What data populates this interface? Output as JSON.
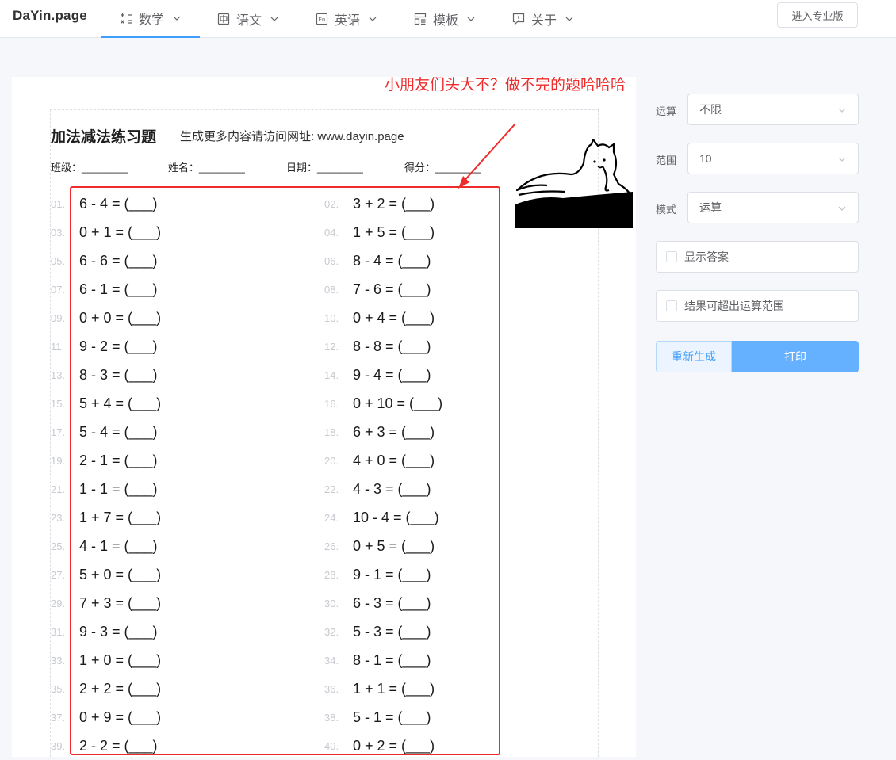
{
  "brand": "DaYin.page",
  "nav": [
    {
      "label": "数学",
      "icon": "calculator-icon",
      "active": true
    },
    {
      "label": "语文",
      "icon": "chinese-char-icon",
      "active": false
    },
    {
      "label": "英语",
      "icon": "english-icon",
      "active": false
    },
    {
      "label": "模板",
      "icon": "template-icon",
      "active": false
    },
    {
      "label": "关于",
      "icon": "info-message-icon",
      "active": false
    }
  ],
  "pro_button": "进入专业版",
  "sheet": {
    "title": "加法减法练习题",
    "subtitle": "生成更多内容请访问网址:   www.dayin.page",
    "fields": [
      "班级：________",
      "姓名：________",
      "日期：________",
      "得分：________"
    ],
    "problems": [
      {
        "no": "01.",
        "expr": "6 - 4 = (___)"
      },
      {
        "no": "02.",
        "expr": "3 + 2 = (___)"
      },
      {
        "no": "03.",
        "expr": "0 + 1 = (___)"
      },
      {
        "no": "04.",
        "expr": "1 + 5 = (___)"
      },
      {
        "no": "05.",
        "expr": "6 - 6 = (___)"
      },
      {
        "no": "06.",
        "expr": "8 - 4 = (___)"
      },
      {
        "no": "07.",
        "expr": "6 - 1 = (___)"
      },
      {
        "no": "08.",
        "expr": "7 - 6 = (___)"
      },
      {
        "no": "09.",
        "expr": "0 + 0 = (___)"
      },
      {
        "no": "10.",
        "expr": "0 + 4 = (___)"
      },
      {
        "no": "11.",
        "expr": "9 - 2 = (___)"
      },
      {
        "no": "12.",
        "expr": "8 - 8 = (___)"
      },
      {
        "no": "13.",
        "expr": "8 - 3 = (___)"
      },
      {
        "no": "14.",
        "expr": "9 - 4 = (___)"
      },
      {
        "no": "15.",
        "expr": "5 + 4 = (___)"
      },
      {
        "no": "16.",
        "expr": "0 + 10 = (___)"
      },
      {
        "no": "17.",
        "expr": "5 - 4 = (___)"
      },
      {
        "no": "18.",
        "expr": "6 + 3 = (___)"
      },
      {
        "no": "19.",
        "expr": "2 - 1 = (___)"
      },
      {
        "no": "20.",
        "expr": "4 + 0 = (___)"
      },
      {
        "no": "21.",
        "expr": "1 - 1 = (___)"
      },
      {
        "no": "22.",
        "expr": "4 - 3 = (___)"
      },
      {
        "no": "23.",
        "expr": "1 + 7 = (___)"
      },
      {
        "no": "24.",
        "expr": "10 - 4 = (___)"
      },
      {
        "no": "25.",
        "expr": "4 - 1 = (___)"
      },
      {
        "no": "26.",
        "expr": "0 + 5 = (___)"
      },
      {
        "no": "27.",
        "expr": "5 + 0 = (___)"
      },
      {
        "no": "28.",
        "expr": "9 - 1 = (___)"
      },
      {
        "no": "29.",
        "expr": "7 + 3 = (___)"
      },
      {
        "no": "30.",
        "expr": "6 - 3 = (___)"
      },
      {
        "no": "31.",
        "expr": "9 - 3 = (___)"
      },
      {
        "no": "32.",
        "expr": "5 - 3 = (___)"
      },
      {
        "no": "33.",
        "expr": "1 + 0 = (___)"
      },
      {
        "no": "34.",
        "expr": "8 - 1 = (___)"
      },
      {
        "no": "35.",
        "expr": "2 + 2 = (___)"
      },
      {
        "no": "36.",
        "expr": "1 + 1 = (___)"
      },
      {
        "no": "37.",
        "expr": "0 + 9 = (___)"
      },
      {
        "no": "38.",
        "expr": "5 - 1 = (___)"
      },
      {
        "no": "39.",
        "expr": "2 - 2 = (___)"
      },
      {
        "no": "40.",
        "expr": "0 + 2 = (___)"
      }
    ]
  },
  "annotation": "小朋友们头大不？做不完的题哈哈哈",
  "settings": {
    "operation_label": "运算",
    "operation_value": "不限",
    "range_label": "范围",
    "range_value": "10",
    "mode_label": "模式",
    "mode_value": "运算",
    "show_answer": "显示答案",
    "allow_overflow": "结果可超出运算范围",
    "regenerate": "重新生成",
    "print": "打印"
  },
  "colors": {
    "accent": "#409eff",
    "annotation": "#ef2c2c"
  }
}
